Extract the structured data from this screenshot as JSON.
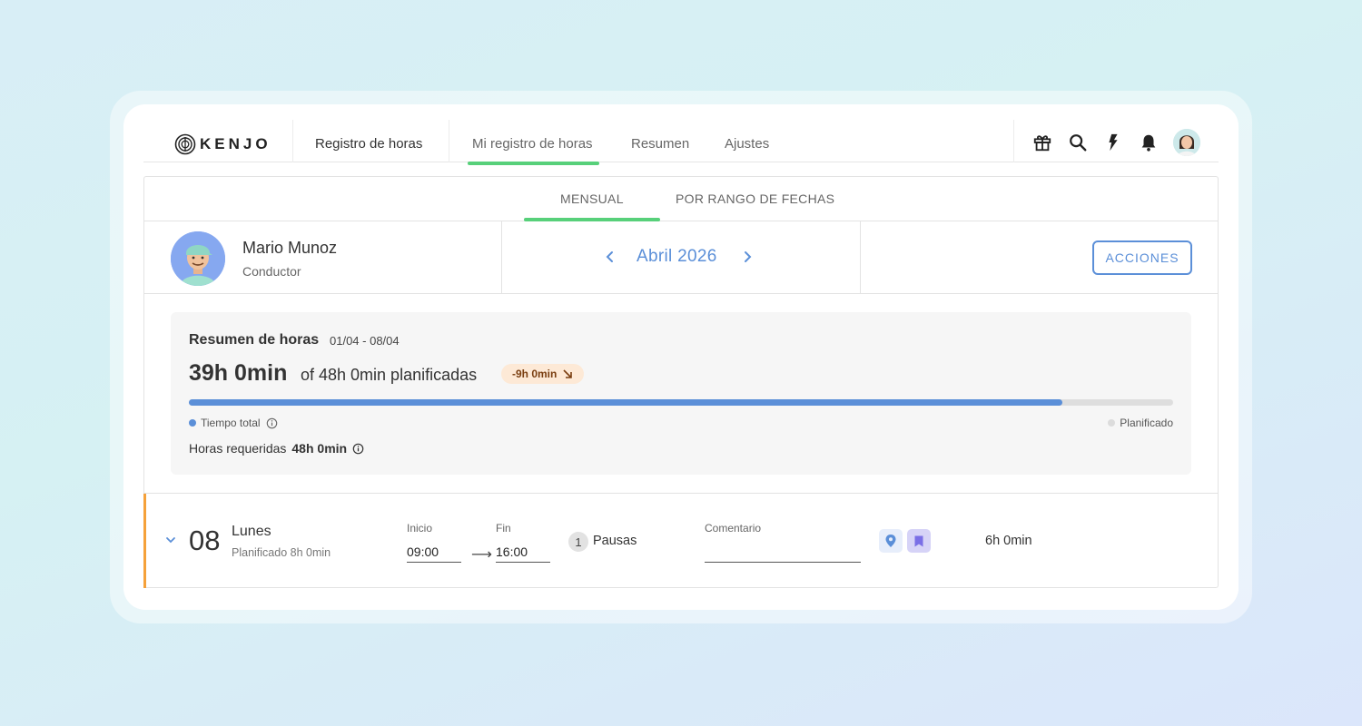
{
  "app": {
    "logo_text": "KENJO",
    "colors": {
      "accent_green": "#57d07a",
      "accent_blue": "#5b8fd8",
      "warning_orange": "#f5a13a"
    }
  },
  "topnav": {
    "section_title": "Registro de horas",
    "tabs": [
      {
        "label": "Mi registro de horas",
        "active": true
      },
      {
        "label": "Resumen",
        "active": false
      },
      {
        "label": "Ajustes",
        "active": false
      }
    ],
    "icons": [
      "gift-icon",
      "search-icon",
      "bolt-icon",
      "bell-icon",
      "user-avatar"
    ]
  },
  "subtabs": [
    {
      "label": "MENSUAL",
      "active": true
    },
    {
      "label": "POR RANGO DE FECHAS",
      "active": false
    }
  ],
  "user": {
    "name": "Mario Munoz",
    "role": "Conductor"
  },
  "period": {
    "label": "Abril 2026"
  },
  "actions_label": "ACCIONES",
  "summary": {
    "title": "Resumen de horas",
    "range": "01/04 - 08/04",
    "total": "39h 0min",
    "of_planned": "of 48h 0min planificadas",
    "difference": "-9h 0min",
    "progress_fraction": 0.8875,
    "legend_total": "Tiempo total",
    "legend_planned": "Planificado",
    "required_label": "Horas requeridas",
    "required_value": "48h 0min"
  },
  "day": {
    "number": "08",
    "name": "Lunes",
    "planned": "Planificado 8h 0min",
    "start_label": "Inicio",
    "start_value": "09:00",
    "end_label": "Fin",
    "end_value": "16:00",
    "pause_count": "1",
    "pause_label": "Pausas",
    "comment_label": "Comentario",
    "comment_value": "",
    "total": "6h 0min"
  }
}
